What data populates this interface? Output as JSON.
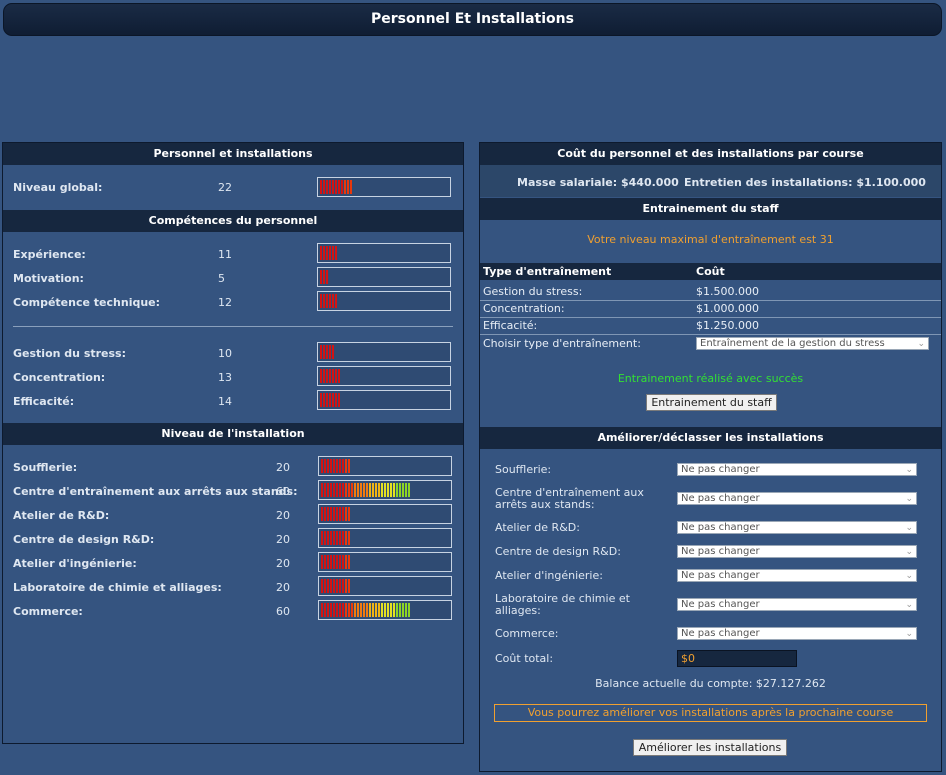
{
  "page": {
    "title": "Personnel Et Installations"
  },
  "left": {
    "section1": {
      "header": "Personnel et installations",
      "global": {
        "label": "Niveau global:",
        "value": "22",
        "level": 22
      }
    },
    "section2": {
      "header": "Compétences du personnel",
      "skills_a": [
        {
          "label": "Expérience:",
          "value": "11",
          "level": 11
        },
        {
          "label": "Motivation:",
          "value": "5",
          "level": 5
        },
        {
          "label": "Compétence technique:",
          "value": "12",
          "level": 12
        }
      ],
      "skills_b": [
        {
          "label": "Gestion du stress:",
          "value": "10",
          "level": 10
        },
        {
          "label": "Concentration:",
          "value": "13",
          "level": 13
        },
        {
          "label": "Efficacité:",
          "value": "14",
          "level": 14
        }
      ]
    },
    "section3": {
      "header": "Niveau de l'installation",
      "facilities": [
        {
          "label": "Soufflerie:",
          "value": "20",
          "level": 20
        },
        {
          "label": "Centre d'entraînement aux arrêts aux stands:",
          "value": "60",
          "level": 60
        },
        {
          "label": "Atelier de R&D:",
          "value": "20",
          "level": 20
        },
        {
          "label": "Centre de design R&D:",
          "value": "20",
          "level": 20
        },
        {
          "label": "Atelier d'ingénierie:",
          "value": "20",
          "level": 20
        },
        {
          "label": "Laboratoire de chimie et alliages:",
          "value": "20",
          "level": 20
        },
        {
          "label": "Commerce:",
          "value": "60",
          "level": 60
        }
      ]
    }
  },
  "right": {
    "cost": {
      "header": "Coût du personnel et des installations par course",
      "salary": "Masse salariale: $440.000",
      "maintenance": "Entretien des installations: $1.100.000"
    },
    "training": {
      "header": "Entrainement du staff",
      "max_level": "Votre niveau maximal d'entraînement est 31",
      "col_type": "Type d'entraînement",
      "col_cost": "Coût",
      "rows": [
        {
          "type": "Gestion du stress:",
          "cost": "$1.500.000"
        },
        {
          "type": "Concentration:",
          "cost": "$1.000.000"
        },
        {
          "type": "Efficacité:",
          "cost": "$1.250.000"
        }
      ],
      "choose_label": "Choisir type d'entraînement:",
      "choose_value": "Entraînement de la gestion du stress",
      "success": "Entrainement réalisé avec succès",
      "button": "Entrainement du staff"
    },
    "upgrade": {
      "header": "Améliorer/déclasser les installations",
      "rows": [
        {
          "label": "Soufflerie:",
          "option": "Ne pas changer"
        },
        {
          "label": "Centre d'entraînement aux arrêts aux stands:",
          "option": "Ne pas changer"
        },
        {
          "label": "Atelier de R&D:",
          "option": "Ne pas changer"
        },
        {
          "label": "Centre de design R&D:",
          "option": "Ne pas changer"
        },
        {
          "label": "Atelier d'ingénierie:",
          "option": "Ne pas changer"
        },
        {
          "label": "Laboratoire de chimie et alliages:",
          "option": "Ne pas changer"
        },
        {
          "label": "Commerce:",
          "option": "Ne pas changer"
        }
      ],
      "total_label": "Coût total:",
      "total_value": "$0",
      "balance": "Balance actuelle du compte: $27.127.262",
      "notice": "Vous pourrez améliorer vos installations après la prochaine course",
      "button": "Améliorer les installations"
    }
  },
  "colors": {
    "background": "#355480",
    "header": "#16273f",
    "accent_orange": "#f0a030",
    "success_green": "#33e033"
  }
}
